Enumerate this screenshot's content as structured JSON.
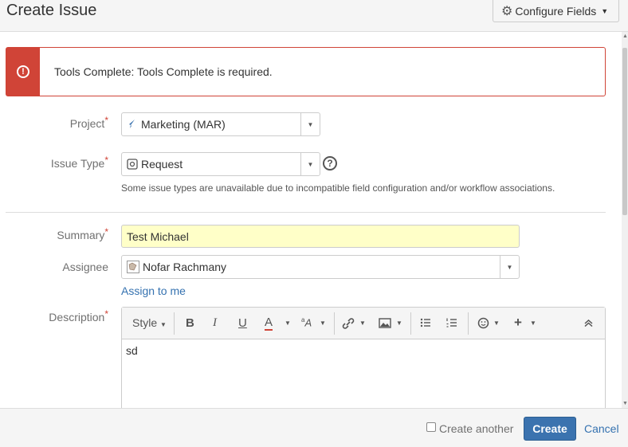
{
  "header": {
    "title": "Create Issue",
    "configure_label": "Configure Fields"
  },
  "error": {
    "message": "Tools Complete: Tools Complete is required."
  },
  "project": {
    "label": "Project",
    "value": "Marketing (MAR)"
  },
  "issue_type": {
    "label": "Issue Type",
    "value": "Request",
    "note": "Some issue types are unavailable due to incompatible field configuration and/or workflow associations."
  },
  "summary": {
    "label": "Summary",
    "value": "Test Michael"
  },
  "assignee": {
    "label": "Assignee",
    "value": "Nofar Rachmany",
    "assign_to_me": "Assign to me"
  },
  "description": {
    "label": "Description",
    "value": "sd",
    "toolbar": {
      "style": "Style",
      "bold": "B",
      "italic": "I",
      "underline": "U",
      "text_color": "A"
    }
  },
  "footer": {
    "create_another": "Create another",
    "create": "Create",
    "cancel": "Cancel"
  },
  "colors": {
    "error": "#d04437",
    "primary": "#3b73af",
    "summary_bg": "#ffffc8"
  }
}
